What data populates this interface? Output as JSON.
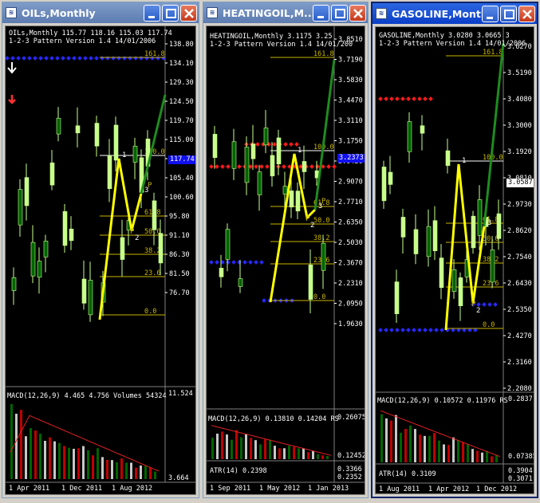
{
  "windows": [
    {
      "id": "oil",
      "title": "OILs,Monthly",
      "active": false,
      "info": "OILs,Monthly  115.77  118.16  115.03  117.74",
      "subinfo": "1-2-3 Pattern  Version 1.4  14/01/2006",
      "price_tag": "117.74",
      "y_labels": [
        "138.80",
        "134.10",
        "129.30",
        "124.50",
        "119.70",
        "115.00",
        "110.20",
        "105.40",
        "100.60",
        "95.80",
        "91.10",
        "86.30",
        "81.50",
        "76.70"
      ],
      "fib_labels": [
        "161.8",
        "100.0",
        "61.8",
        "50.0",
        "38.2",
        "23.6",
        "0.0"
      ],
      "pattern_labels": [
        "1",
        "2",
        "3"
      ],
      "p_marks": [
        "P",
        "P"
      ],
      "indicator1": "MACD(12,26,9) 4.465 4.756  Volumes 54324",
      "ind1_scale": [
        "11.524",
        "3.664"
      ],
      "indicator2": "",
      "ind2_scale": [],
      "x_labels": [
        "1 Apr 2011",
        "1 Dec 2011",
        "1 Aug 2012"
      ]
    },
    {
      "id": "heating",
      "title": "HEATINGOIL,M...",
      "active": false,
      "info": "HEATINGOIL,Monthly  3.1175 3.25",
      "subinfo": "1-2-3 Pattern  Version 1.4  14/01/200",
      "price_tag": "3.2373",
      "y_labels": [
        "3.8510",
        "3.7190",
        "3.5830",
        "3.4470",
        "3.3110",
        "3.1750",
        "3.0430",
        "2.9070",
        "2.7710",
        "2.6350",
        "2.5030",
        "2.3670",
        "2.2310",
        "2.0950",
        "1.9630"
      ],
      "fib_labels": [
        "161.8",
        "100.0",
        "61.8",
        "50.0",
        "38.2",
        "23.6",
        "0.0"
      ],
      "pattern_labels": [
        "1",
        "2",
        "3"
      ],
      "p_marks": [
        "P",
        "P"
      ],
      "indicator1": "MACD(12,26,9) 0.13810 0.14204  RS",
      "ind1_scale": [
        "0.26075",
        "0.12452"
      ],
      "indicator2": "ATR(14) 0.2398",
      "ind2_scale": [
        "0.3366",
        "0.2352"
      ],
      "x_labels": [
        "1 Sep 2011",
        "1 May 2012",
        "1 Jan 2013"
      ]
    },
    {
      "id": "gasoline",
      "title": "GASOLINE,Monthly",
      "active": true,
      "info": "GASOLINE,Monthly  3.0280 3.0665 3",
      "subinfo": "1-2-3 Pattern  Version 1.4  14/01/2006",
      "price_tag": "3.0587",
      "y_labels": [
        "3.6270",
        "3.5190",
        "3.4080",
        "3.3000",
        "3.1920",
        "3.0810",
        "2.9730",
        "2.8620",
        "2.7540",
        "2.6430",
        "2.5350",
        "2.4270",
        "2.3160",
        "2.2080"
      ],
      "fib_labels": [
        "161.8",
        "100.0",
        "61.8",
        "50.0",
        "38.2",
        "23.6",
        "0.0"
      ],
      "pattern_labels": [
        "1",
        "2",
        "3"
      ],
      "p_marks": [
        "P"
      ],
      "indicator1": "MACD(12,26,9) 0.10572 0.11976  RS",
      "ind1_scale": [
        "0.2837",
        "0.07385"
      ],
      "indicator2": "ATR(14) 0.3109",
      "ind2_scale": [
        "0.3904",
        "0.3071"
      ],
      "x_labels": [
        "1 Aug 2011",
        "1 Apr 2012",
        "1 Dec 2012"
      ]
    }
  ],
  "colors": {
    "candle_up": "#c8ff8c",
    "candle_down": "#006400",
    "pattern": "#ffff00",
    "projection": "#1e8c1e",
    "fib": "#c8b400",
    "resistance": "#ff1a1a",
    "support": "#2828ff"
  },
  "icons": [
    "chart-window-icon",
    "minimize-icon",
    "maximize-icon",
    "close-icon",
    "down-arrow-icon"
  ]
}
